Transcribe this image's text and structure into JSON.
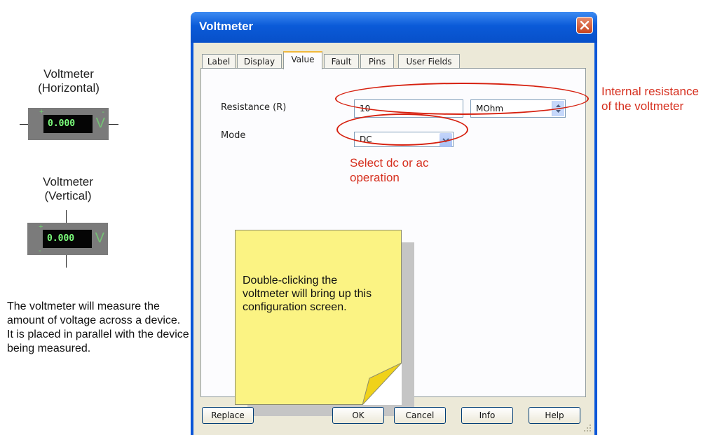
{
  "left_panel": {
    "horizontal_caption": [
      "Voltmeter",
      "(Horizontal)"
    ],
    "vertical_caption": [
      "Voltmeter",
      "(Vertical)"
    ],
    "meter_reading_h": "0.000",
    "meter_reading_v": "0.000",
    "meter_unit": "V",
    "plus": "+",
    "minus": "-",
    "description": "The voltmeter will measure the amount of voltage across a device.  It is placed in parallel with the device being measured."
  },
  "dialog": {
    "title": "Voltmeter",
    "tabs": [
      "Label",
      "Display",
      "Value",
      "Fault",
      "Pins",
      "User Fields"
    ],
    "active_tab": "Value",
    "resistance_label": "Resistance (R)",
    "resistance_value": "10",
    "resistance_unit": "MOhm",
    "mode_label": "Mode",
    "mode_value": "DC",
    "buttons": {
      "replace": "Replace",
      "ok": "OK",
      "cancel": "Cancel",
      "info": "Info",
      "help": "Help"
    }
  },
  "annotations": {
    "resistance_note": [
      "Internal resistance",
      "of the voltmeter"
    ],
    "mode_note": [
      "Select dc or ac",
      "operation"
    ],
    "sticky_note": "Double-clicking the voltmeter will bring up this configuration screen.",
    "highlight_color": "#d6200f"
  }
}
